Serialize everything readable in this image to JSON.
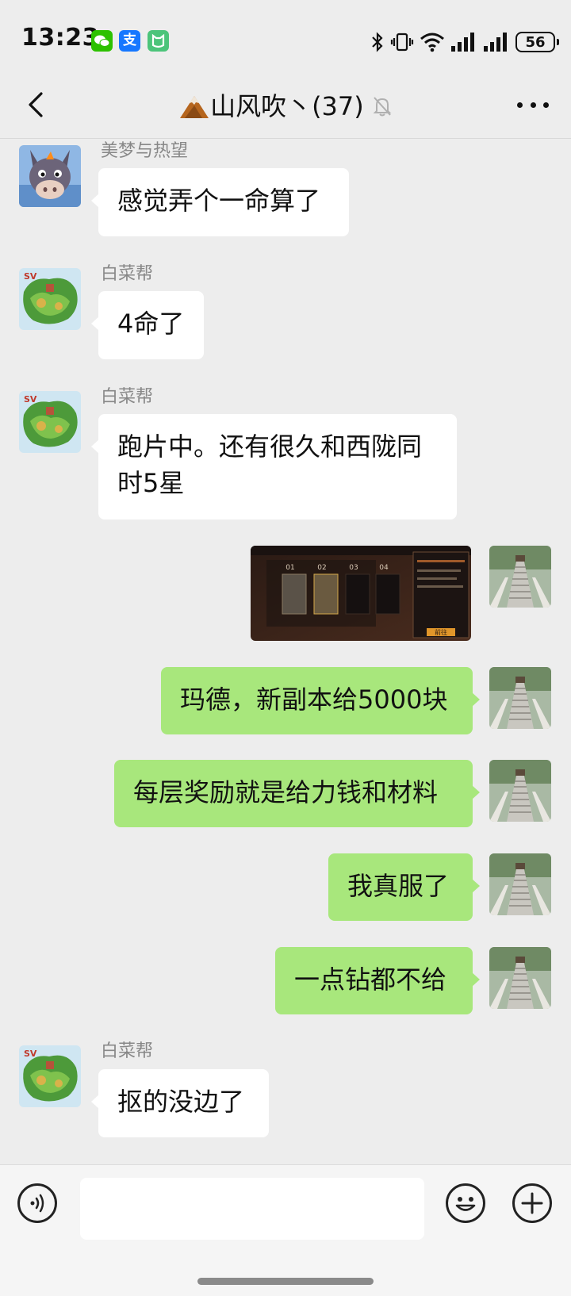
{
  "status_bar": {
    "time": "13:23",
    "battery": "56"
  },
  "header": {
    "title": "山风吹丶(37)"
  },
  "messages": [
    {
      "sender": "美梦与热望",
      "text": "感觉弄个一命算了"
    },
    {
      "sender": "白菜帮",
      "text": "4命了"
    },
    {
      "sender": "白菜帮",
      "text": "跑片中。还有很久和西陇同时5星"
    },
    {
      "type": "image",
      "tabs": [
        "01",
        "02",
        "03",
        "04"
      ],
      "button": "前往"
    },
    {
      "text": "玛德，新副本给5000块"
    },
    {
      "text": "每层奖励就是给力钱和材料"
    },
    {
      "text": "我真服了"
    },
    {
      "text": "一点钻都不给"
    },
    {
      "sender": "白菜帮",
      "text": "抠的没边了"
    }
  ],
  "input": {
    "value": ""
  },
  "colors": {
    "bubble_out": "#a8e77c",
    "bubble_in": "#ffffff",
    "background": "#ededed"
  }
}
